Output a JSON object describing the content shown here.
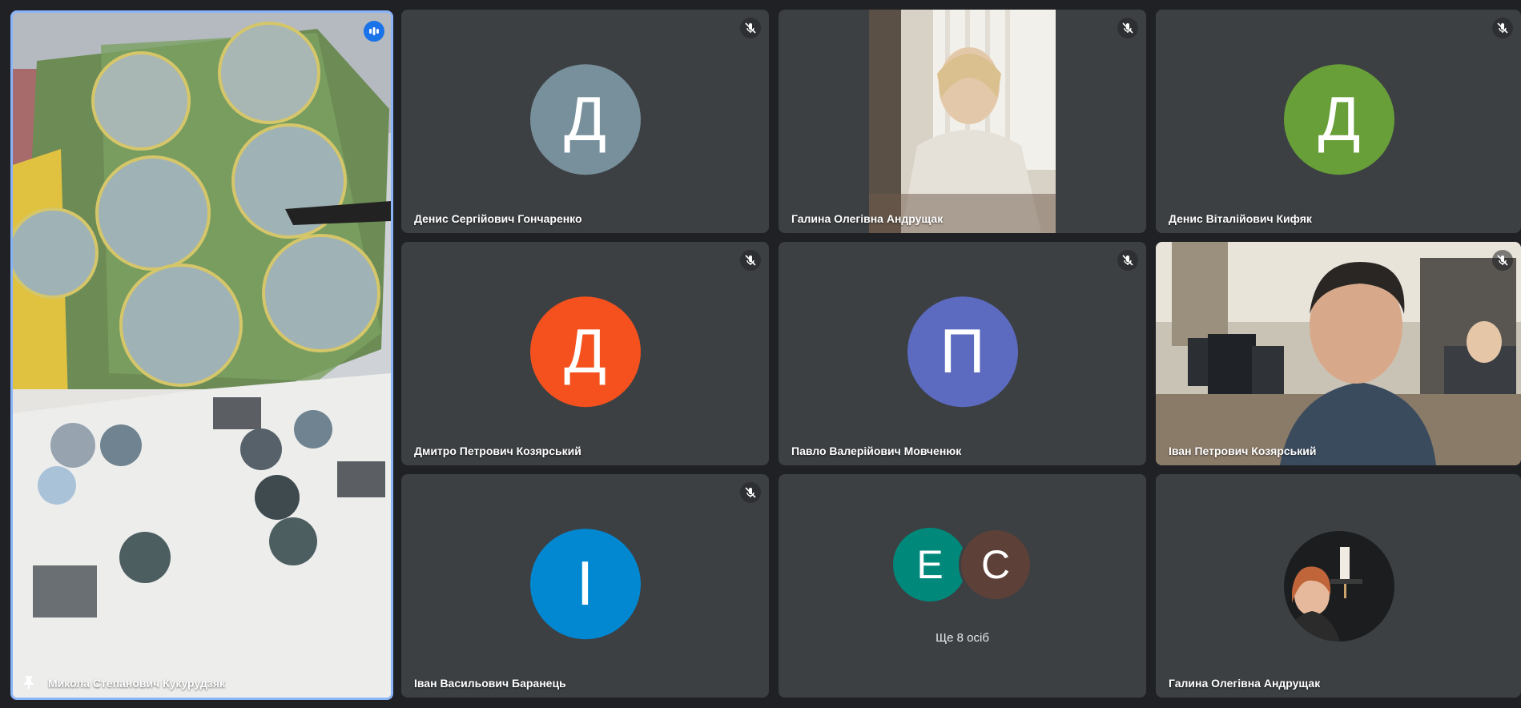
{
  "pinned": {
    "name": "Микола Степанович Кукурудзяк",
    "pin_icon": "pin-icon",
    "speaking_icon": "audio-level-icon",
    "accent": "#8ab4f8"
  },
  "tiles": [
    {
      "name": "Денис Сергійович Гончаренко",
      "initial": "Д",
      "color": "#78909c",
      "muted": true
    },
    {
      "name": "Галина Олегівна Андрущак",
      "video": true,
      "muted": true
    },
    {
      "name": "Денис Віталійович Кифяк",
      "initial": "Д",
      "color": "#689f38",
      "muted": true
    },
    {
      "name": "Дмитро Петрович Козярський",
      "initial": "Д",
      "color": "#f4511e",
      "muted": true
    },
    {
      "name": "Павло Валерійович Мовченюк",
      "initial": "П",
      "color": "#5c6bc0",
      "muted": true
    },
    {
      "name": "Іван Петрович Козярський",
      "video": true,
      "muted": true
    },
    {
      "name": "Іван Васильович Баранець",
      "initial": "І",
      "color": "#0288d1",
      "muted": true
    },
    {
      "overflow": true,
      "initials": [
        {
          "letter": "Е",
          "color": "#00897b"
        },
        {
          "letter": "С",
          "color": "#5d4037"
        }
      ],
      "label": "Ще 8 осіб"
    },
    {
      "name": "Галина Олегівна Андрущак",
      "photo_avatar": true
    }
  ],
  "icons": {
    "muted": "mic-off-icon"
  }
}
